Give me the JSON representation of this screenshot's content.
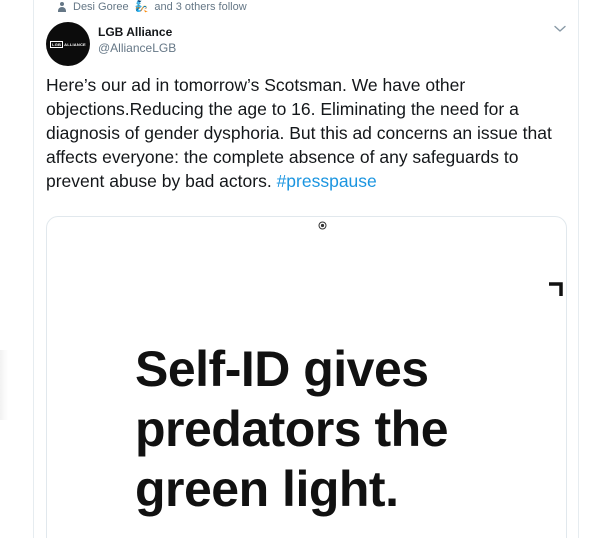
{
  "social_context": {
    "text": "Desi Goree",
    "suffix": "and 3 others follow",
    "emoji": "🧞"
  },
  "author": {
    "display_name": "LGB Alliance",
    "handle": "@AllianceLGB",
    "avatar_logo_box": "LGB",
    "avatar_logo_text": "ALLIANCE"
  },
  "tweet": {
    "text": "Here’s our ad in tomorrow’s Scotsman. We have other objections.Reducing the age to 16. Eliminating the need for a diagnosis of gender dysphoria. But this ad concerns an issue that affects everyone: the complete absence of any safeguards to prevent abuse by bad actors. ",
    "hashtag": "#presspause"
  },
  "media": {
    "headline": "Self-ID gives predators the green light."
  },
  "colors": {
    "link": "#1b95e0",
    "secondary_text": "#657786",
    "border": "#e1e8ed"
  },
  "icons": {
    "person": "person-icon",
    "caret": "chevron-down-icon"
  }
}
